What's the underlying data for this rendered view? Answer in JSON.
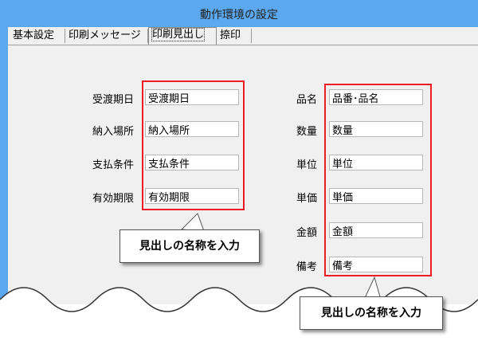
{
  "window": {
    "title": "動作環境の設定"
  },
  "tabs": [
    {
      "label": "基本設定",
      "active": false
    },
    {
      "label": "印刷メッセージ",
      "active": false
    },
    {
      "label": "印刷見出し",
      "active": true
    },
    {
      "label": "捺印",
      "active": false
    }
  ],
  "left_fields": [
    {
      "label": "受渡期日",
      "value": "受渡期日"
    },
    {
      "label": "納入場所",
      "value": "納入場所"
    },
    {
      "label": "支払条件",
      "value": "支払条件"
    },
    {
      "label": "有効期限",
      "value": "有効期限"
    }
  ],
  "right_fields": [
    {
      "label": "品名",
      "value": "品番･品名"
    },
    {
      "label": "数量",
      "value": "数量"
    },
    {
      "label": "単位",
      "value": "単位"
    },
    {
      "label": "単価",
      "value": "単価"
    },
    {
      "label": "金額",
      "value": "金額"
    },
    {
      "label": "備考",
      "value": "備考"
    }
  ],
  "callouts": {
    "left": "見出しの名称を入力",
    "right": "見出しの名称を入力"
  },
  "colors": {
    "titlebar": "#5ba8ef",
    "highlight": "#ee1c24",
    "panel": "#f0f0f0"
  }
}
